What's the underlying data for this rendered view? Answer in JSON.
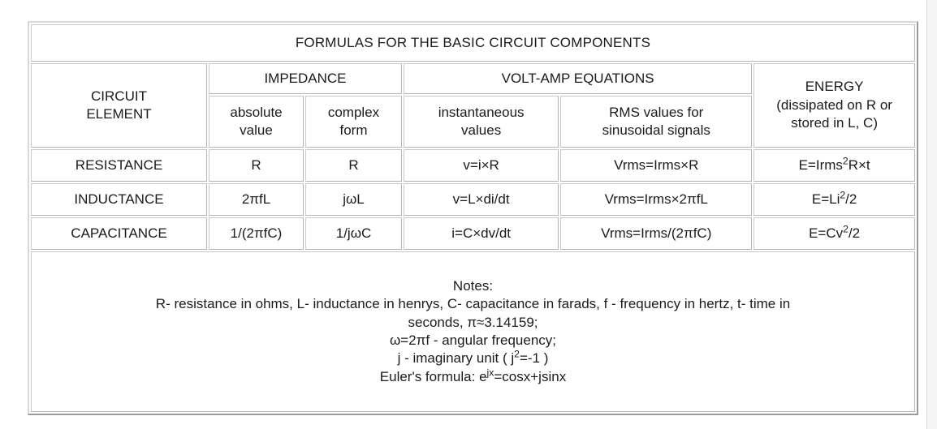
{
  "table": {
    "title": "FORMULAS FOR THE BASIC CIRCUIT COMPONENTS",
    "headers": {
      "circuit_element": "CIRCUIT\nELEMENT",
      "circuit_element_line1": "CIRCUIT",
      "circuit_element_line2": "ELEMENT",
      "impedance": "IMPEDANCE",
      "volt_amp": "VOLT-AMP EQUATIONS",
      "energy": "ENERGY",
      "energy_note_line1": "(dissipated on R or",
      "energy_note_line2": "stored in L, C)",
      "absolute_value_line1": "absolute",
      "absolute_value_line2": "value",
      "complex_form_line1": "complex",
      "complex_form_line2": "form",
      "instantaneous_line1": "instantaneous",
      "instantaneous_line2": "values",
      "rms_line1": "RMS values for",
      "rms_line2": "sinusoidal signals"
    },
    "rows": [
      {
        "element": "RESISTANCE",
        "absolute_value": "R",
        "complex_form": "R",
        "instantaneous": "v=i×R",
        "rms": "Vrms=Irms×R",
        "energy_base_1": "E=Irms",
        "energy_sup_1": "2",
        "energy_base_2": "R×t"
      },
      {
        "element": "INDUCTANCE",
        "absolute_value": "2πfL",
        "complex_form": "jωL",
        "instantaneous": "v=L×di/dt",
        "rms": "Vrms=Irms×2πfL",
        "energy_base_1": "E=Li",
        "energy_sup_1": "2",
        "energy_base_2": "/2"
      },
      {
        "element": "CAPACITANCE",
        "absolute_value": "1/(2πfC)",
        "complex_form": "1/jωC",
        "instantaneous": "i=C×dv/dt",
        "rms": "Vrms=Irms/(2πfC)",
        "energy_base_1": "E=Cv",
        "energy_sup_1": "2",
        "energy_base_2": "/2"
      }
    ],
    "notes": {
      "heading": "Notes:",
      "line_definitions_1": "R- resistance in ohms, L- inductance in henrys, C- capacitance in farads, f - frequency in hertz, t- time in",
      "line_definitions_2": "seconds, π≈3.14159;",
      "line_omega": "ω=2πf - angular frequency;",
      "line_j_prefix": "j - imaginary unit ( j",
      "line_j_sup": "2",
      "line_j_suffix": "=-1 )",
      "line_euler_prefix": "Euler's formula: e",
      "line_euler_sup": "jx",
      "line_euler_suffix": "=cosx+jsinx"
    }
  },
  "colors": {
    "title_background": "#ececec",
    "cell_background": "#ffffff",
    "border": "#b4b4b4",
    "text": "#1b1b1b",
    "page_gutter": "#f5f5f5"
  }
}
